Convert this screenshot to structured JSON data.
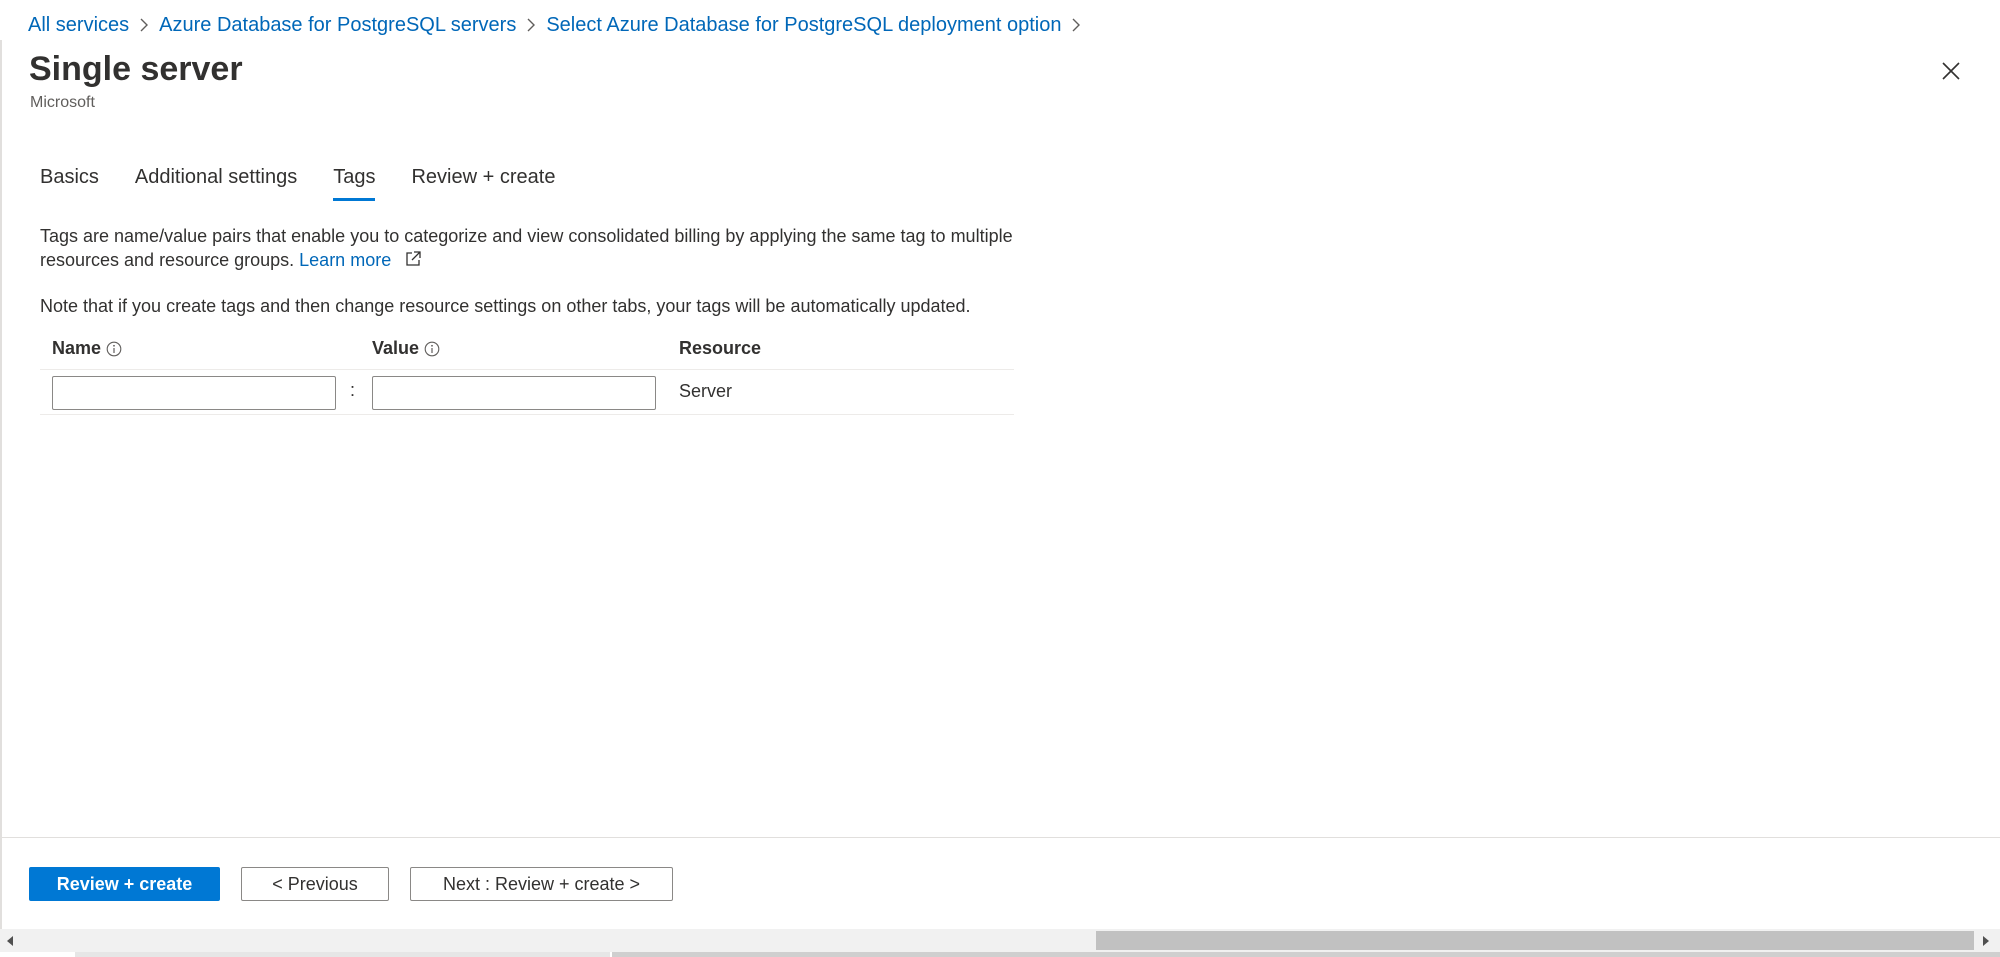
{
  "breadcrumb": {
    "items": [
      {
        "label": "All services"
      },
      {
        "label": "Azure Database for PostgreSQL servers"
      },
      {
        "label": "Select Azure Database for PostgreSQL deployment option"
      }
    ]
  },
  "header": {
    "title": "Single server",
    "subtitle": "Microsoft"
  },
  "tabs": [
    {
      "label": "Basics",
      "active": false
    },
    {
      "label": "Additional settings",
      "active": false
    },
    {
      "label": "Tags",
      "active": true
    },
    {
      "label": "Review + create",
      "active": false
    }
  ],
  "description": {
    "text": "Tags are name/value pairs that enable you to categorize and view consolidated billing by applying the same tag to multiple resources and resource groups.",
    "learn_more": "Learn more",
    "note": "Note that if you create tags and then change resource settings on other tabs, your tags will be automatically updated."
  },
  "tags_table": {
    "headers": {
      "name": "Name",
      "value": "Value",
      "resource": "Resource"
    },
    "rows": [
      {
        "name": "",
        "value": "",
        "separator": ":",
        "resource": "Server"
      }
    ]
  },
  "footer": {
    "review_create": "Review + create",
    "previous": "< Previous",
    "next": "Next : Review + create >"
  },
  "colors": {
    "link": "#0067b8",
    "accent": "#0078d4",
    "text": "#323130",
    "muted": "#605e5c"
  },
  "icons": [
    "chevron-right-icon",
    "close-icon",
    "external-link-icon",
    "info-icon",
    "scroll-left-arrow-icon",
    "scroll-right-arrow-icon"
  ]
}
